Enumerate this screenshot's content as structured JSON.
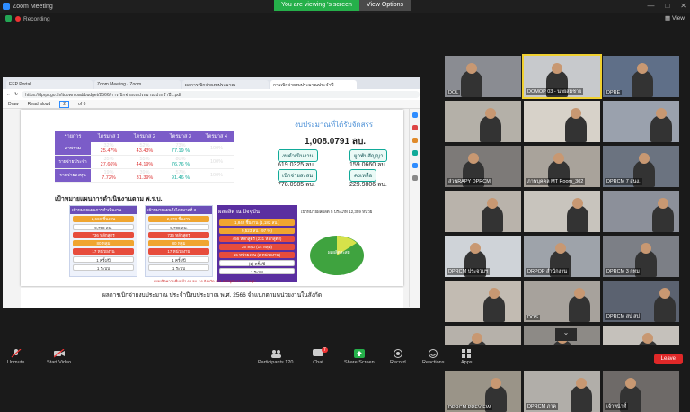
{
  "window": {
    "title": "Zoom Meeting"
  },
  "share_banner": {
    "message": "You are viewing 's screen",
    "options": "View Options"
  },
  "infobar": {
    "recording": "Recording",
    "view": "View"
  },
  "browser": {
    "tabs": [
      "EEP Portal",
      "Zoom Meeting - Zoom",
      "ผลการเบิกจ่ายงบประมาณ",
      "การเบิกจ่ายงบประมาณประจำปี"
    ],
    "url": "https://dprpr.go.th/itdownload/budget/2566/การเบิกจ่ายงบประมาณประจำปี...pdf",
    "pdf_toolbar": [
      "Draw",
      "Read aloud",
      "of 6"
    ],
    "page_counter": "2"
  },
  "slide": {
    "summary_title": "งบประมาณที่ได้รับจัดสรร",
    "summary_total": "1,008.0791 ลบ.",
    "pills": [
      {
        "label": "งบดำเนินงาน",
        "value": "619.0325 ลบ."
      },
      {
        "label": "ผูกพันสัญญา",
        "value": "159.0660 ลบ."
      },
      {
        "label": "เบิกจ่ายสะสม",
        "value": "778.0985 ลบ."
      },
      {
        "label": "คงเหลือ",
        "value": "229.9806 ลบ."
      }
    ],
    "table": {
      "headers": [
        "รายการ",
        "ไตรมาส 1",
        "ไตรมาส 2",
        "ไตรมาส 3",
        "ไตรมาส 4"
      ],
      "rows": [
        {
          "label": "ภาพรวม",
          "cells": [
            [
              "32%",
              "25.47%"
            ],
            [
              "52%",
              "43.43%"
            ],
            [
              "73%",
              "77.19 %"
            ],
            [
              "100%",
              ""
            ]
          ]
        },
        {
          "label": "รายจ่ายประจำ",
          "cells": [
            [
              "35%",
              "27.66%"
            ],
            [
              "55%",
              "44.19%"
            ],
            [
              "80%",
              "76.76 %"
            ],
            [
              "100%",
              ""
            ]
          ]
        },
        {
          "label": "รายจ่ายลงทุน",
          "cells": [
            [
              "19%",
              "7.72%"
            ],
            [
              "39%",
              "31.39%"
            ],
            [
              "57%",
              "91.46 %"
            ],
            [
              "100%",
              ""
            ]
          ]
        }
      ]
    },
    "section_title": "เป้าหมายแผนการดำเนินงานตาม พ.ร.บ.",
    "panels": [
      {
        "head": "เป้าหมายแผนการดำเนินงาน",
        "boxes": [
          "2,660 ชิ้นงาน",
          "9,758 ลบ.",
          "736 หลักสูตร",
          "80 หลุม",
          "17 หน่วยงาน",
          "1 ครั้ง/ปี",
          "1 ระบบ"
        ]
      },
      {
        "head": "เป้าหมายแผนถึงไตรมาสที่ 3",
        "boxes": [
          "2,078 ชิ้นงาน",
          "9,708 ลบ.",
          "736 หลักสูตร",
          "80 หลุม",
          "17 หน่วยงาน",
          "1 ครั้ง/ปี",
          "1 ระบบ"
        ]
      }
    ],
    "current": {
      "head": "ผลผลิต ณ ปัจจุบัน",
      "lines": [
        "1,842 ชิ้นงาน (1,182 ลบ.)",
        "9,523 ลบ. (97 %)",
        "456 หลักสูตร (231 หลักสูตร)",
        "35 หลุม (14 หลุม)",
        "15 หน่วยงาน (2 หน่วยงาน)",
        "(1) ครั้ง/ปี",
        "1 ระบบ"
      ]
    },
    "pie_caption": "เป้าหมายผลผลิต 5 ประเภท 12,359 หน่วย",
    "pie_label": "ผลผลิตสะสม",
    "note": "*ผลผลิตความคืบหน้า 63 ลบ. / 6 จังหวัด / 13 หลักสูตร/งาน 29 หลุม",
    "page2_title": "ผลการเบิกจ่ายงบประมาณ ประจำปีงบประมาณ พ.ศ. 2566 จำแนกตามหน่วยงานในสังกัด"
  },
  "participants": [
    {
      "name": "DOL",
      "hl": false
    },
    {
      "name": "DOMOP 03 - นายสมชาย",
      "hl": true
    },
    {
      "name": "DPRE",
      "hl": false
    },
    {
      "name": "",
      "hl": false
    },
    {
      "name": "",
      "hl": false
    },
    {
      "name": "",
      "hl": false
    },
    {
      "name": "ส่วนRAPY DPRCM",
      "hl": false
    },
    {
      "name": "ภาพบุคคล MT Room_302",
      "hl": false
    },
    {
      "name": "DPRCM 7 สนง.",
      "hl": false
    },
    {
      "name": "",
      "hl": false
    },
    {
      "name": "",
      "hl": false
    },
    {
      "name": "",
      "hl": false
    },
    {
      "name": "DPRCM ประจวบฯ",
      "hl": false
    },
    {
      "name": "DRPOP สำนักงาน",
      "hl": false
    },
    {
      "name": "DPRCM 3 กทม",
      "hl": false
    },
    {
      "name": "",
      "hl": false
    },
    {
      "name": "DOS",
      "hl": false
    },
    {
      "name": "DPRCM สป สป",
      "hl": false
    },
    {
      "name": "",
      "hl": false
    },
    {
      "name": "Regional",
      "hl": false
    },
    {
      "name": "",
      "hl": false
    },
    {
      "name": "DPRCM PREVIEW",
      "hl": false
    },
    {
      "name": "DPRCM ภาค",
      "hl": false
    },
    {
      "name": "เจ้าหน้าที่",
      "hl": false
    }
  ],
  "toolbar": {
    "unmute": "Unmute",
    "start_video": "Start Video",
    "participants": "Participants",
    "participants_count": "120",
    "chat": "Chat",
    "chat_badge": "7",
    "share": "Share Screen",
    "record": "Record",
    "reactions": "Reactions",
    "apps": "Apps",
    "leave": "Leave"
  },
  "colors": {
    "accent": "#2d8cff",
    "share_green": "#25b04a",
    "leave_red": "#e02828",
    "slide_purple": "#7b5cc8"
  }
}
